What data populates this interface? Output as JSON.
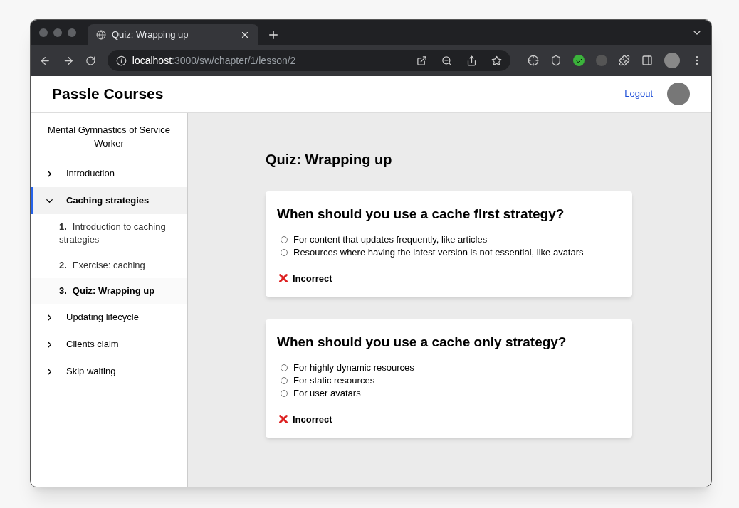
{
  "browser": {
    "tab": {
      "title": "Quiz: Wrapping up"
    },
    "url": "**localhost**:3000/sw/chapter/1/lesson/2"
  },
  "header": {
    "brand": "Passle Courses",
    "logout": "Logout"
  },
  "sidebar": {
    "course_title": "Mental Gymnastics of Service Worker",
    "chapters": [
      {
        "label": "Introduction",
        "expanded": false,
        "selected": false
      },
      {
        "label": "Caching strategies",
        "expanded": true,
        "selected": true,
        "lessons": [
          {
            "number": "1.",
            "label": "Introduction to caching strategies",
            "selected": false
          },
          {
            "number": "2.",
            "label": "Exercise: caching",
            "selected": false
          },
          {
            "number": "3.",
            "label": "Quiz: Wrapping up",
            "selected": true
          }
        ]
      },
      {
        "label": "Updating lifecycle",
        "expanded": false,
        "selected": false
      },
      {
        "label": "Clients claim",
        "expanded": false,
        "selected": false
      },
      {
        "label": "Skip waiting",
        "expanded": false,
        "selected": false
      }
    ]
  },
  "main": {
    "title": "Quiz: Wrapping up",
    "questions": [
      {
        "question": "When should you use a cache first strategy?",
        "options": [
          {
            "label": "For content that updates frequently, like articles",
            "checked": false
          },
          {
            "label": "Resources where having the latest version is not essential, like avatars",
            "checked": false
          }
        ],
        "result": {
          "kind": "incorrect",
          "label": "Incorrect"
        }
      },
      {
        "question": "When should you use a cache only strategy?",
        "options": [
          {
            "label": "For highly dynamic resources",
            "checked": false
          },
          {
            "label": "For static resources",
            "checked": false
          },
          {
            "label": "For user avatars",
            "checked": false
          }
        ],
        "result": {
          "kind": "incorrect",
          "label": "Incorrect"
        }
      }
    ]
  }
}
